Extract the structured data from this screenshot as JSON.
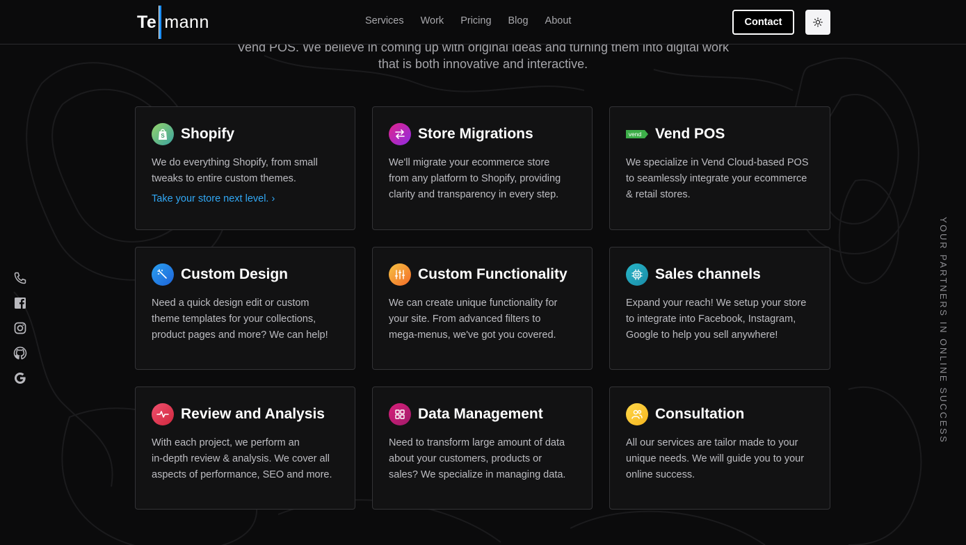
{
  "header": {
    "logo": {
      "part1": "Te",
      "part2": "mann"
    },
    "nav": [
      "Services",
      "Work",
      "Pricing",
      "Blog",
      "About"
    ],
    "contact_label": "Contact",
    "theme_icon": "sun-icon"
  },
  "intro": {
    "line1": "Vend POS. We believe in coming up with original ideas and turning them into digital work",
    "line2": "that is both innovative and interactive."
  },
  "cards": [
    {
      "title": "Shopify",
      "icon": "shopify-bag-icon",
      "desc1": "We do everything Shopify, from small",
      "desc2": "tweaks to entire custom themes.",
      "desc3": "",
      "link": "Take your store next level. ›"
    },
    {
      "title": "Store Migrations",
      "icon": "swap-arrows-icon",
      "desc1": "We'll migrate your ecommerce store",
      "desc2": "from any platform to Shopify, providing",
      "desc3": "clarity and transparency in every step."
    },
    {
      "title": "Vend POS",
      "icon": "vend-logo-icon",
      "badge": "vend",
      "desc1": "We specialize in Vend Cloud-based POS",
      "desc2": "to seamlessly integrate your ecommerce",
      "desc3": "& retail stores."
    },
    {
      "title": "Custom Design",
      "icon": "magic-wand-icon",
      "desc1": "Need a quick design edit or custom",
      "desc2": "theme templates for your collections,",
      "desc3": "product pages and more? We can help!"
    },
    {
      "title": "Custom Functionality",
      "icon": "sliders-icon",
      "desc1": "We can create unique functionality for",
      "desc2": "your site. From advanced filters to",
      "desc3": "mega-menus, we've got you covered."
    },
    {
      "title": "Sales channels",
      "icon": "chip-icon",
      "desc1": "Expand your reach! We setup your store",
      "desc2": "to integrate into Facebook, Instagram,",
      "desc3": "Google to help you sell anywhere!"
    },
    {
      "title": "Review and Analysis",
      "icon": "pulse-icon",
      "desc1": "With each project, we perform an",
      "desc2": "in-depth review & analysis. We cover all",
      "desc3": "aspects of performance, SEO and more."
    },
    {
      "title": "Data Management",
      "icon": "grid-icon",
      "desc1": "Need to transform large amount of data",
      "desc2": "about your customers, products or",
      "desc3": "sales? We specialize in managing data."
    },
    {
      "title": "Consultation",
      "icon": "people-icon",
      "desc1": "All our services are tailor made to your",
      "desc2": "unique needs. We will guide you to your",
      "desc3": "online success."
    }
  ],
  "social": [
    "phone-icon",
    "facebook-icon",
    "instagram-icon",
    "github-icon",
    "google-icon"
  ],
  "side_text": "YOUR PARTNERS IN ONLINE SUCCESS",
  "colors": {
    "background": "#0b0b0c",
    "card": "#121213",
    "link": "#31a8f5",
    "logo_bar": "#1e90ff"
  }
}
